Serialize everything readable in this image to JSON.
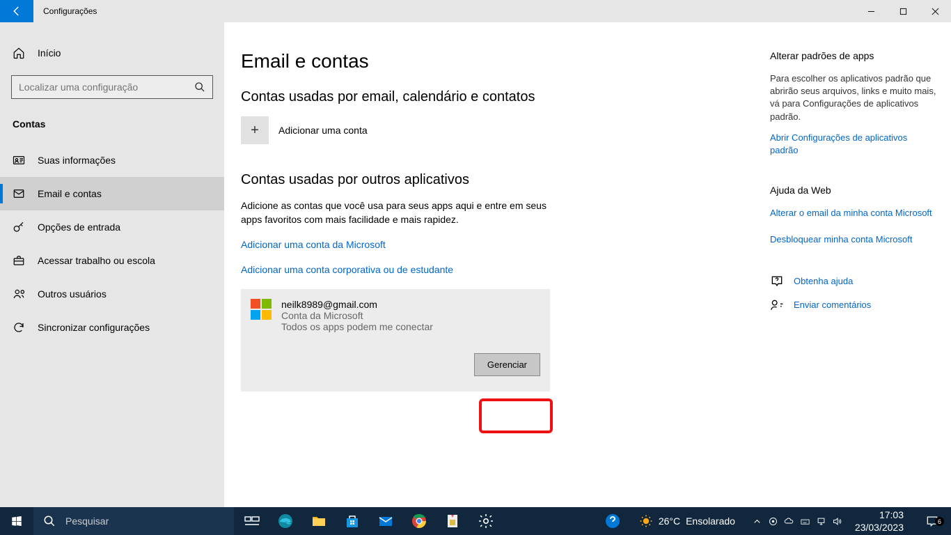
{
  "titlebar": {
    "title": "Configurações"
  },
  "sidebar": {
    "home": "Início",
    "search_placeholder": "Localizar uma configuração",
    "category": "Contas",
    "items": [
      {
        "label": "Suas informações"
      },
      {
        "label": "Email e contas"
      },
      {
        "label": "Opções de entrada"
      },
      {
        "label": "Acessar trabalho ou escola"
      },
      {
        "label": "Outros usuários"
      },
      {
        "label": "Sincronizar configurações"
      }
    ]
  },
  "main": {
    "h1": "Email e contas",
    "sec1_title": "Contas usadas por email, calendário e contatos",
    "add_account": "Adicionar uma conta",
    "sec2_title": "Contas usadas por outros aplicativos",
    "sec2_desc": "Adicione as contas que você usa para seus apps aqui e entre em seus apps favoritos com mais facilidade e mais rapidez.",
    "link_add_ms": "Adicionar uma conta da Microsoft",
    "link_add_work": "Adicionar uma conta corporativa ou de estudante",
    "account": {
      "email": "neilk8989@gmail.com",
      "type": "Conta da Microsoft",
      "status": "Todos os apps podem me conectar",
      "manage_btn": "Gerenciar"
    }
  },
  "aside": {
    "s1_title": "Alterar padrões de apps",
    "s1_para": "Para escolher os aplicativos padrão que abrirão seus arquivos, links e muito mais, vá para Configurações de aplicativos padrão.",
    "s1_link": "Abrir Configurações de aplicativos padrão",
    "s2_title": "Ajuda da Web",
    "s2_link1": "Alterar o email da minha conta Microsoft",
    "s2_link2": "Desbloquear minha conta Microsoft",
    "help_link": "Obtenha ajuda",
    "feedback_link": "Enviar comentários"
  },
  "taskbar": {
    "search_placeholder": "Pesquisar",
    "weather_temp": "26°C",
    "weather_label": "Ensolarado",
    "time": "17:03",
    "date": "23/03/2023",
    "notif_badge": "6"
  }
}
